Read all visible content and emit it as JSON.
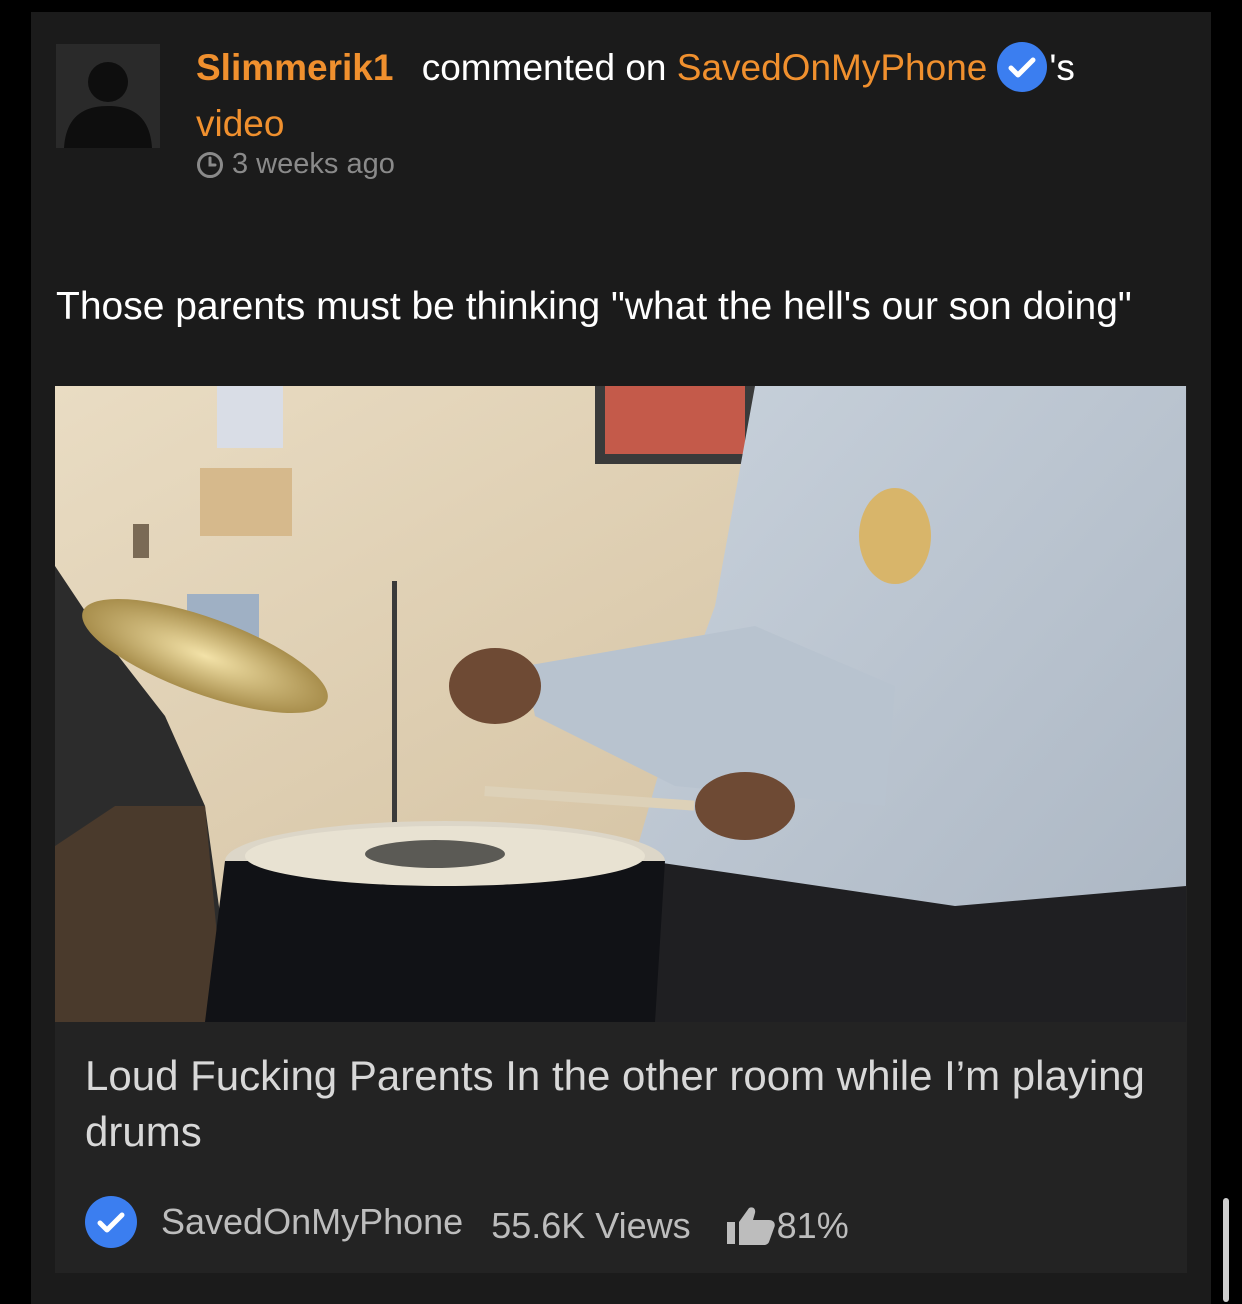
{
  "comment": {
    "username": "Slimmerik1",
    "action_text": "commented on",
    "channel_name": "SavedOnMyPhone",
    "possessive": "'s",
    "target_text": "video",
    "timestamp": "3 weeks ago",
    "body": "Those parents must be thinking \"what the hell's our son doing\""
  },
  "video": {
    "title": "Loud Fucking Parents In the other room while I’m playing drums",
    "channel": "SavedOnMyPhone",
    "views": "55.6K Views",
    "rating": "81%"
  },
  "colors": {
    "accent": "#f0902e",
    "verified": "#3b7ef0",
    "card_bg": "#1b1b1b"
  },
  "icons": [
    "user-silhouette-icon",
    "verified-icon",
    "clock-icon",
    "thumbs-up-icon"
  ]
}
